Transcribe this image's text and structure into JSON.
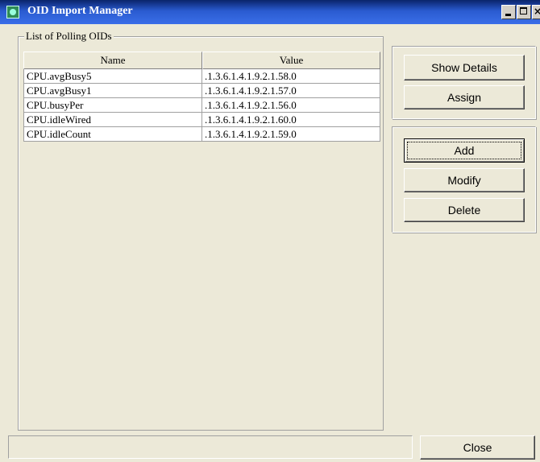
{
  "window": {
    "title": "OID Import Manager",
    "minimize_glyph": "",
    "maximize_glyph": "",
    "close_glyph": "×"
  },
  "group": {
    "label": "List of Polling OIDs"
  },
  "table": {
    "columns": [
      "Name",
      "Value"
    ],
    "rows": [
      [
        "CPU.avgBusy5",
        ".1.3.6.1.4.1.9.2.1.58.0"
      ],
      [
        "CPU.avgBusy1",
        ".1.3.6.1.4.1.9.2.1.57.0"
      ],
      [
        "CPU.busyPer",
        ".1.3.6.1.4.1.9.2.1.56.0"
      ],
      [
        "CPU.idleWired",
        ".1.3.6.1.4.1.9.2.1.60.0"
      ],
      [
        "CPU.idleCount",
        ".1.3.6.1.4.1.9.2.1.59.0"
      ]
    ]
  },
  "buttons": {
    "show_details": "Show Details",
    "assign": "Assign",
    "add": "Add",
    "modify": "Modify",
    "delete": "Delete",
    "close": "Close"
  },
  "icons": {
    "app": "app-icon",
    "minimize": "minimize-icon",
    "maximize": "maximize-icon",
    "close": "close-icon"
  },
  "colors": {
    "titlebar": "#0a246a",
    "background": "#ece9d8"
  }
}
